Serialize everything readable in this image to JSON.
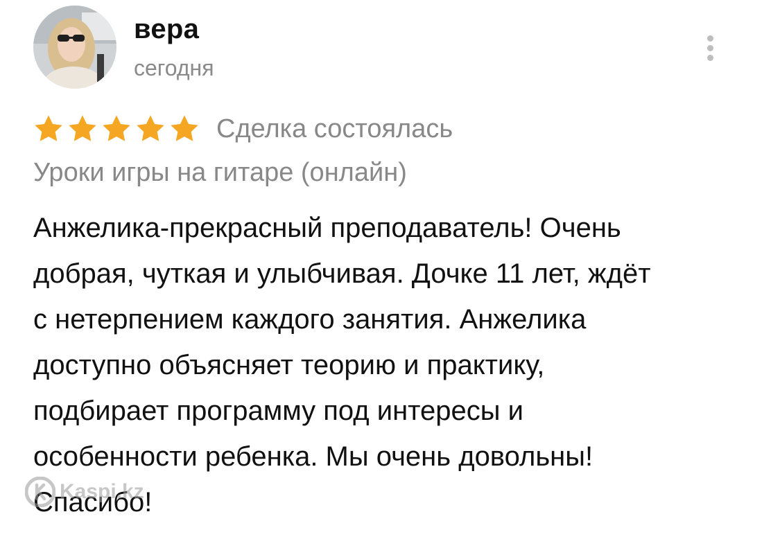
{
  "review": {
    "author": {
      "name": "вера",
      "date": "сегодня",
      "avatar": "avatar-photo"
    },
    "more_icon": "more-vertical-icon",
    "rating": {
      "value": 5,
      "max": 5,
      "star_color": "#F5A623"
    },
    "deal_status": "Сделка состоялась",
    "service": "Уроки игры на гитаре (онлайн)",
    "text": "Анжелика-прекрасный преподаватель! Очень\nдобрая, чуткая и улыбчивая. Дочке 11 лет, ждёт\nс нетерпением каждого занятия. Анжелика\nдоступно объясняет теорию и практику,\nподбирает  программу под интересы и\nособенности ребенка. Мы очень довольны!\nСпасибо!"
  },
  "watermark": {
    "text": "Kaspi.kz",
    "icon": "kaspi-logo-icon"
  }
}
